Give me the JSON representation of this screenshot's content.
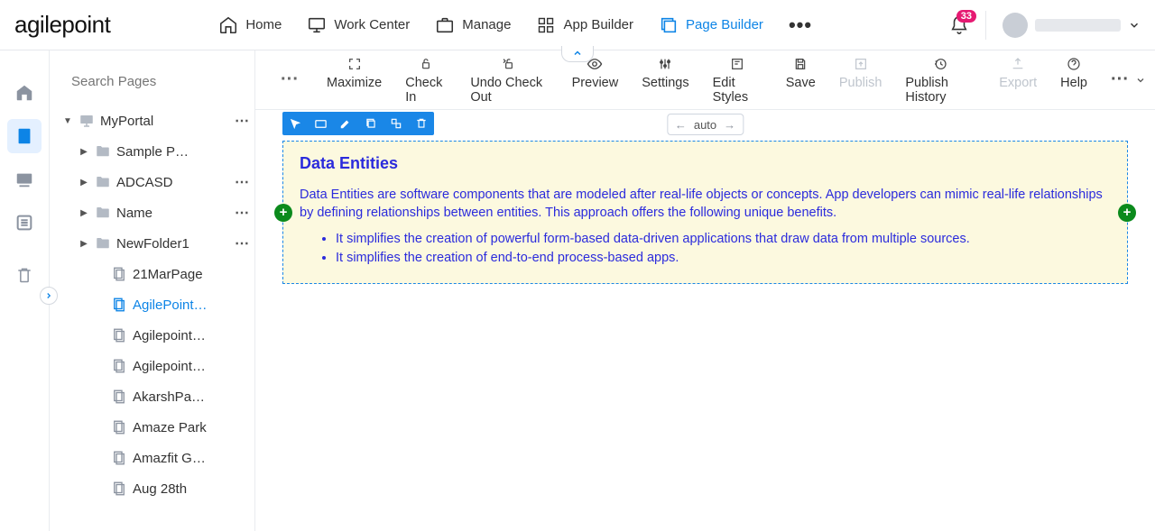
{
  "logo": "agilepoint",
  "nav": [
    {
      "label": "Home"
    },
    {
      "label": "Work Center"
    },
    {
      "label": "Manage"
    },
    {
      "label": "App Builder"
    },
    {
      "label": "Page Builder"
    }
  ],
  "header": {
    "notifications": "33"
  },
  "search": {
    "placeholder": "Search Pages"
  },
  "tree": [
    {
      "depth": 0,
      "type": "portal",
      "label": "MyPortal",
      "expanded": true,
      "menu": true
    },
    {
      "depth": 1,
      "type": "folder",
      "label": "Sample P…",
      "collapsed": true
    },
    {
      "depth": 1,
      "type": "folder",
      "label": "ADCASD",
      "collapsed": true,
      "menu": true
    },
    {
      "depth": 1,
      "type": "folder",
      "label": "Name",
      "collapsed": true,
      "menu": true
    },
    {
      "depth": 1,
      "type": "folder",
      "label": "NewFolder1",
      "collapsed": true,
      "menu": true
    },
    {
      "depth": 2,
      "type": "page",
      "label": "21MarPage"
    },
    {
      "depth": 2,
      "type": "page",
      "label": "AgilePoint…",
      "selected": true
    },
    {
      "depth": 2,
      "type": "page",
      "label": "Agilepoint…"
    },
    {
      "depth": 2,
      "type": "page",
      "label": "Agilepoint…"
    },
    {
      "depth": 2,
      "type": "page",
      "label": "AkarshPa…"
    },
    {
      "depth": 2,
      "type": "page",
      "label": "Amaze Park"
    },
    {
      "depth": 2,
      "type": "page",
      "label": "Amazfit G…"
    },
    {
      "depth": 2,
      "type": "page",
      "label": "Aug 28th"
    }
  ],
  "toolbar": [
    {
      "label": "Maximize"
    },
    {
      "label": "Check In"
    },
    {
      "label": "Undo Check Out"
    },
    {
      "label": "Preview"
    },
    {
      "label": "Settings"
    },
    {
      "label": "Edit Styles"
    },
    {
      "label": "Save"
    },
    {
      "label": "Publish",
      "disabled": true
    },
    {
      "label": "Publish History"
    },
    {
      "label": "Export",
      "disabled": true
    },
    {
      "label": "Help"
    }
  ],
  "autopill": "auto",
  "content": {
    "title": "Data Entities",
    "paragraph": "Data Entities are software components that are modeled after real-life objects or concepts. App developers can mimic real-life relationships by defining relationships between entities. This approach offers the following unique benefits.",
    "bullets": [
      "It simplifies the creation of powerful form-based data-driven applications that draw data from multiple sources.",
      "It simplifies the creation of end-to-end process-based apps."
    ]
  }
}
